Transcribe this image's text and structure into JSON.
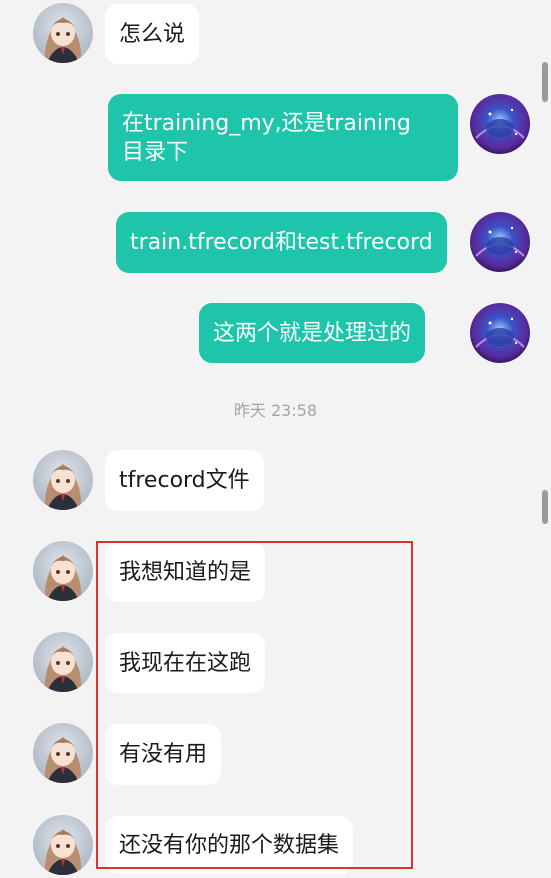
{
  "timestamp": "昨天 23:58",
  "messages": [
    {
      "id": "m1",
      "side": "left",
      "text": "怎么说"
    },
    {
      "id": "m2",
      "side": "right",
      "lines": [
        "在training_my,还是training",
        "目录下"
      ]
    },
    {
      "id": "m3",
      "side": "right",
      "text": "train.tfrecord和test.tfrecord"
    },
    {
      "id": "m4",
      "side": "right",
      "text": "这两个就是处理过的"
    },
    {
      "id": "m5",
      "side": "left",
      "text": "tfrecord文件"
    },
    {
      "id": "m6",
      "side": "left",
      "text": "我想知道的是"
    },
    {
      "id": "m7",
      "side": "left",
      "text": "我现在在这跑"
    },
    {
      "id": "m8",
      "side": "left",
      "text": "有没有用"
    },
    {
      "id": "m9",
      "side": "left",
      "text": "还没有你的那个数据集"
    }
  ],
  "colors": {
    "background": "#f3f3f3",
    "incoming_bubble": "#ffffff",
    "outgoing_bubble": "#1ec5aa",
    "highlight": "#e03131"
  },
  "icons": {
    "incoming_avatar": "anime-girl-avatar-icon",
    "outgoing_avatar": "blue-galaxy-avatar-icon"
  }
}
